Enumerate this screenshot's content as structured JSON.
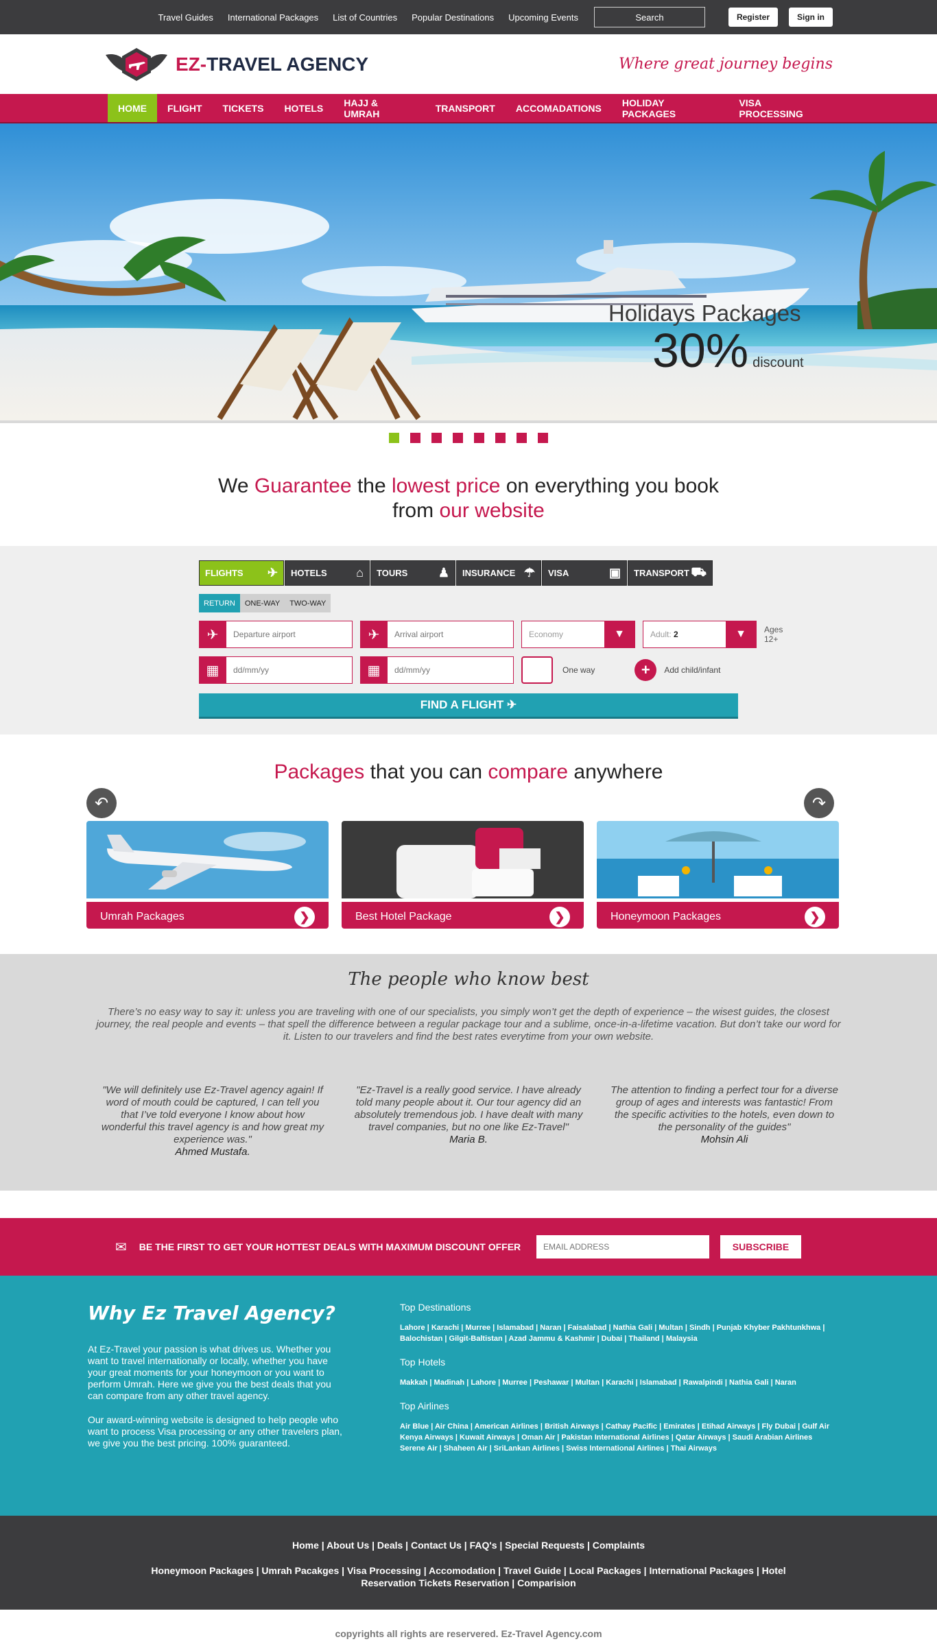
{
  "topbar": {
    "links": [
      "Travel Guides",
      "International Packages",
      "List of Countries",
      "Popular Destinations",
      "Upcoming Events"
    ],
    "search_placeholder": "Search",
    "register": "Register",
    "signin": "Sign in"
  },
  "brand": {
    "prefix": "EZ-",
    "name": "TRAVEL AGENCY",
    "tagline": "Where great journey begins"
  },
  "nav": [
    "HOME",
    "FLIGHT",
    "TICKETS",
    "HOTELS",
    "HAJJ & UMRAH",
    "TRANSPORT",
    "ACCOMADATIONS",
    "HOLIDAY PACKAGES",
    "VISA PROCESSING"
  ],
  "hero": {
    "title": "Holidays Packages",
    "number": "30%",
    "label": "discount",
    "slides": 8,
    "active_slide": 1
  },
  "guarantee": {
    "a": "We ",
    "b": "Guarantee",
    "c": " the ",
    "d": "lowest price",
    "e": " on everything you book",
    "f": "from ",
    "g": "our website"
  },
  "search": {
    "tabs": [
      "FLIGHTS",
      "HOTELS",
      "TOURS",
      "INSURANCE",
      "VISA",
      "TRANSPORT"
    ],
    "trip_types": [
      "RETURN",
      "ONE-WAY",
      "TWO-WAY"
    ],
    "departure_placeholder": "Departure airport",
    "arrival_placeholder": "Arrival airport",
    "date_placeholder": "dd/mm/yy",
    "class_value": "Economy",
    "adult_label": "Adult:",
    "adult_value": "2",
    "ages": "Ages 12+",
    "one_way": "One way",
    "add_child": "Add child/infant",
    "button": "FIND A FLIGHT"
  },
  "packages": {
    "t1": "Packages",
    "t2": " that you can ",
    "t3": "compare",
    "t4": " anywhere",
    "cards": [
      "Umrah Packages",
      "Best Hotel Package",
      "Honeymoon Packages"
    ]
  },
  "people": {
    "title": "The people who know best",
    "text": "There’s no easy way to say it: unless you are traveling with one of our specialists, you simply won’t get the depth of experience – the wisest guides, the closest journey, the real people and events – that spell the difference between a regular package tour and a sublime, once-in-a-lifetime vacation. But don’t take our word for it. Listen to our travelers and find the best rates everytime from your own website.",
    "quotes": [
      {
        "text": "\"We will definitely use Ez-Travel agency again! If word of mouth could be captured, I can tell you that I’ve told everyone I know about how wonderful this travel agency is and how great my experience was.\"",
        "author": "Ahmed Mustafa."
      },
      {
        "text": "\"Ez-Travel is a really good service. I have already told many people about it. Our tour agency did an absolutely tremendous job. I have dealt with many travel companies, but no one like Ez-Travel\"",
        "author": "Maria B."
      },
      {
        "text": "The attention to finding a perfect tour for a diverse group of ages and interests was fantastic! From the specific activities to the hotels, even down to the personality of the guides\"",
        "author": "Mohsin Ali"
      }
    ]
  },
  "newsletter": {
    "text": "BE THE FIRST TO GET YOUR HOTTEST DEALS WITH MAXIMUM DISCOUNT OFFER",
    "placeholder": "EMAIL ADDRESS",
    "button": "SUBSCRIBE"
  },
  "why": {
    "title": "Why Ez Travel Agency?",
    "p1": "At Ez-Travel your passion is what drives us. Whether you want to travel internationally or locally, whether you have your great moments for your honeymoon or you want to perform Umrah. Here we give you the best deals that you can compare from any other travel agency.",
    "p2": "Our award-winning website is designed to help people who want to process Visa processing or any other travelers plan, we give you the best pricing. 100% guaranteed.",
    "dest_title": "Top Destinations",
    "dest": "Lahore | Karachi | Murree | Islamabad | Naran | Faisalabad | Nathia Gali | Multan | Sindh | Punjab Khyber Pakhtunkhwa | Balochistan | Gilgit-Baltistan | Azad Jammu & Kashmir | Dubai | Thailand | Malaysia",
    "hotels_title": "Top Hotels",
    "hotels": "Makkah | Madinah | Lahore | Murree | Peshawar | Multan | Karachi | Islamabad | Rawalpindi | Nathia Gali | Naran",
    "air_title": "Top Airlines",
    "air": "Air Blue | Air China | American Airlines | British Airways | Cathay Pacific | Emirates | Etihad Airways | Fly Dubai | Gulf Air Kenya Airways | Kuwait Airways | Oman Air | Pakistan International Airlines | Qatar Airways | Saudi Arabian Airlines Serene Air | Shaheen Air | SriLankan Airlines | Swiss International Airlines | Thai Airways"
  },
  "footer": {
    "row1": "Home | About Us | Deals | Contact Us | FAQ's | Special Requests | Complaints",
    "row2": "Honeymoon Packages | Umrah Pacakges | Visa Processing | Accomodation | Travel Guide | Local Packages | International Packages | Hotel Reservation Tickets Reservation | Comparision",
    "copyright": "copyrights all rights are reservered. Ez-Travel Agency.com"
  },
  "colors": {
    "brand": "#c5184e",
    "accent_green": "#8cc21a",
    "teal": "#21a1b2",
    "dark": "#3c3c3e"
  }
}
